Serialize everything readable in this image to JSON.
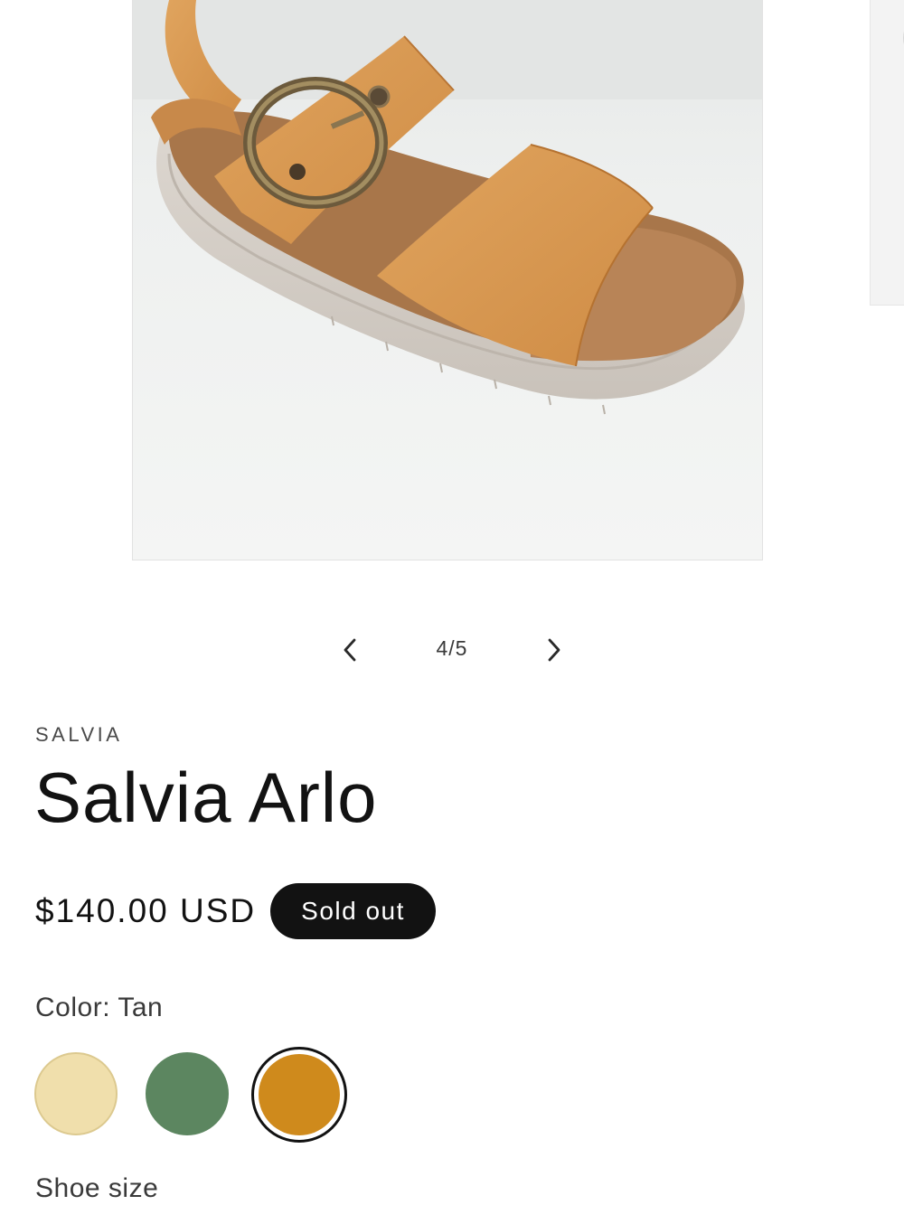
{
  "gallery": {
    "image_alt": "Salvia Arlo",
    "counter_current": "4",
    "counter_separator": "/",
    "counter_total": "5",
    "counter_text": "4/5",
    "prev_icon": "chevron-left-icon",
    "next_icon": "chevron-right-icon"
  },
  "product": {
    "vendor": "SALVIA",
    "title": "Salvia Arlo",
    "price": "$140.00 USD",
    "badge": "Sold out"
  },
  "color": {
    "legend": "Color: Tan",
    "options": [
      {
        "name": "Cream",
        "hex": "#f0dfac",
        "selected": false
      },
      {
        "name": "Green",
        "hex": "#5c8660",
        "selected": false
      },
      {
        "name": "Tan",
        "hex": "#cf8a1c",
        "selected": true
      }
    ]
  },
  "size": {
    "legend": "Shoe size"
  },
  "colors": {
    "text": "#121212",
    "badge_bg": "#121212",
    "badge_text": "#ffffff"
  }
}
